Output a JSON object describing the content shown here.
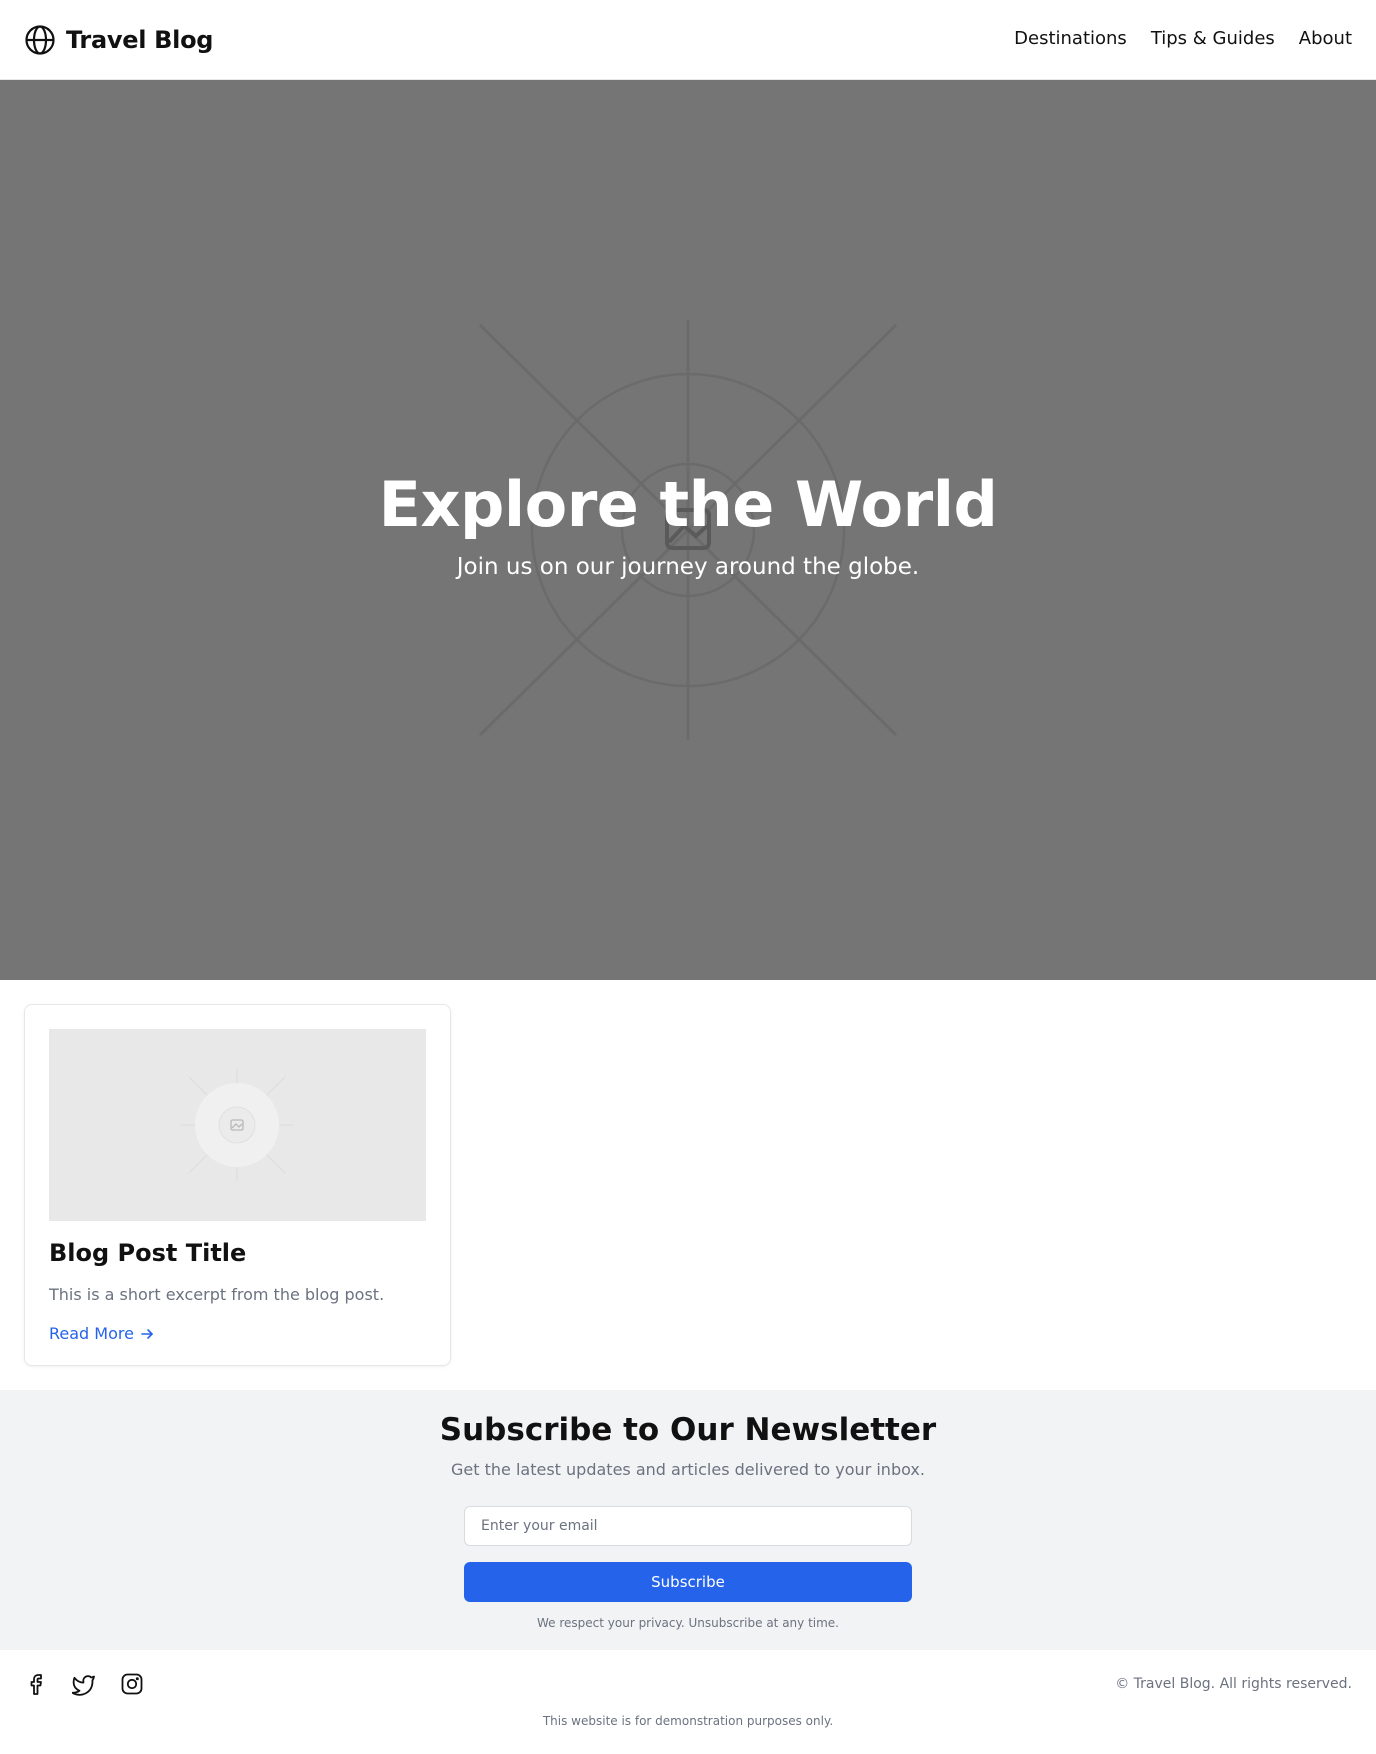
{
  "header": {
    "brand": "Travel Blog",
    "nav": [
      {
        "label": "Destinations"
      },
      {
        "label": "Tips & Guides"
      },
      {
        "label": "About"
      }
    ]
  },
  "hero": {
    "title": "Explore the World",
    "subtitle": "Join us on our journey around the globe.",
    "background_color": "#757575",
    "image_icon": "image-placeholder-icon"
  },
  "posts": [
    {
      "title": "Blog Post Title",
      "excerpt": "This is a short excerpt from the blog post.",
      "link_label": "Read More",
      "link_icon": "arrow-right-icon",
      "image_icon": "image-placeholder-icon"
    }
  ],
  "newsletter": {
    "title": "Subscribe to Our Newsletter",
    "subtitle": "Get the latest updates and articles delivered to your inbox.",
    "email_placeholder": "Enter your email",
    "email_value": "",
    "button_label": "Subscribe",
    "note": "We respect your privacy. Unsubscribe at any time."
  },
  "footer": {
    "socials": [
      {
        "icon": "facebook-icon"
      },
      {
        "icon": "twitter-icon"
      },
      {
        "icon": "instagram-icon"
      }
    ],
    "copyright": "© Travel Blog. All rights reserved.",
    "disclaimer": "This website is for demonstration purposes only."
  },
  "colors": {
    "accent": "#2563eb",
    "muted_text": "#6b7280",
    "newsletter_bg": "#f2f3f5"
  }
}
